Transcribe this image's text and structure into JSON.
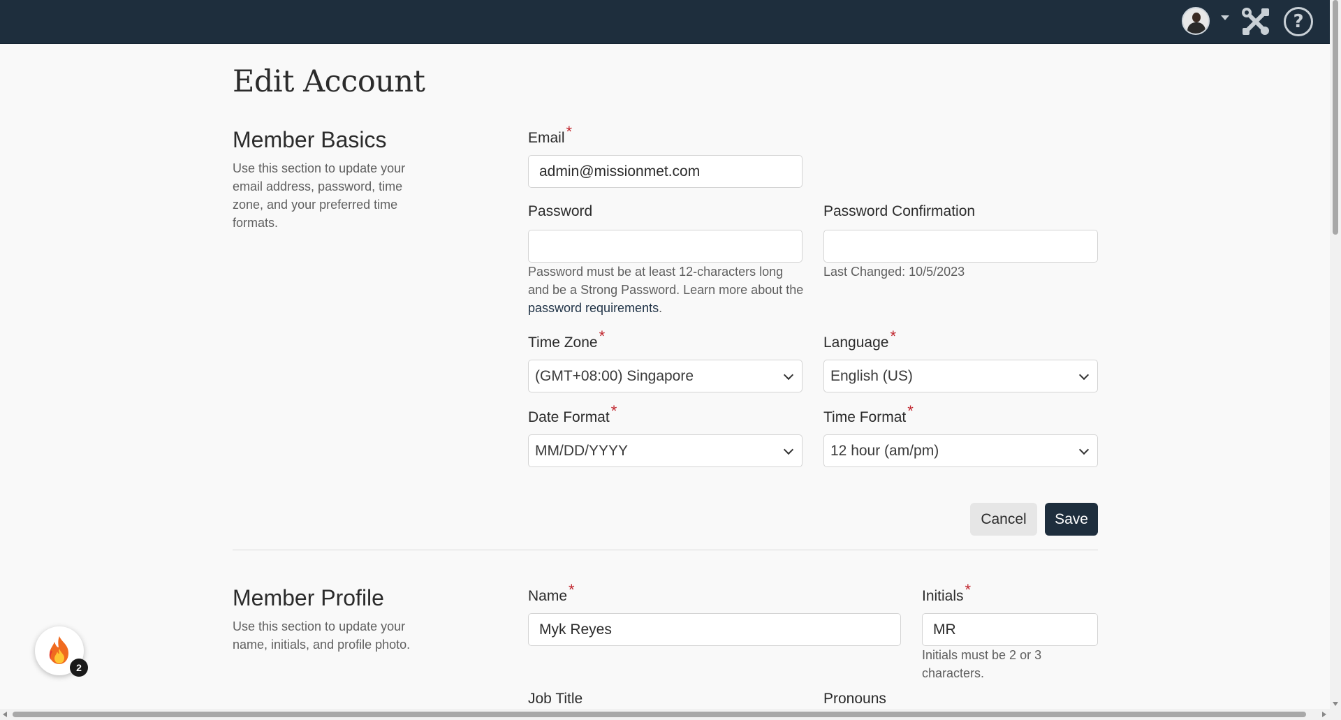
{
  "page_title": "Edit Account",
  "member_basics": {
    "title": "Member Basics",
    "description": "Use this section to update your email address, password, time zone, and your preferred time formats.",
    "email": {
      "label": "Email",
      "required": "*",
      "value": "admin@missionmet.com"
    },
    "password": {
      "label": "Password",
      "value": ""
    },
    "password_help": {
      "text": "Password must be at least 12-characters long and be a Strong Password. Learn more about the ",
      "link": "password requirements",
      "end": "."
    },
    "password_confirmation": {
      "label": "Password Confirmation",
      "value": ""
    },
    "last_changed": "Last Changed: 10/5/2023",
    "time_zone": {
      "label": "Time Zone",
      "required": "*",
      "value": "(GMT+08:00) Singapore"
    },
    "language": {
      "label": "Language",
      "required": "*",
      "value": "English (US)"
    },
    "date_format": {
      "label": "Date Format",
      "required": "*",
      "value": "MM/DD/YYYY"
    },
    "time_format": {
      "label": "Time Format",
      "required": "*",
      "value": "12 hour (am/pm)"
    },
    "cancel_label": "Cancel",
    "save_label": "Save"
  },
  "member_profile": {
    "title": "Member Profile",
    "description": "Use this section to update your name, initials, and profile photo.",
    "name": {
      "label": "Name",
      "required": "*",
      "value": "Myk Reyes"
    },
    "initials": {
      "label": "Initials",
      "required": "*",
      "value": "MR"
    },
    "initials_help": "Initials must be 2 or 3 characters.",
    "job_title": {
      "label": "Job Title"
    },
    "pronouns": {
      "label": "Pronouns"
    }
  },
  "header": {
    "icons": [
      "avatar",
      "chevron-down-icon",
      "tools-icon",
      "help-icon"
    ],
    "help_glyph": "?"
  },
  "fab": {
    "icon": "flame-icon",
    "badge": "2"
  },
  "colors": {
    "header_bg": "#1e2e3d",
    "required": "#c0252d",
    "save_bg": "#1e2e3d"
  }
}
